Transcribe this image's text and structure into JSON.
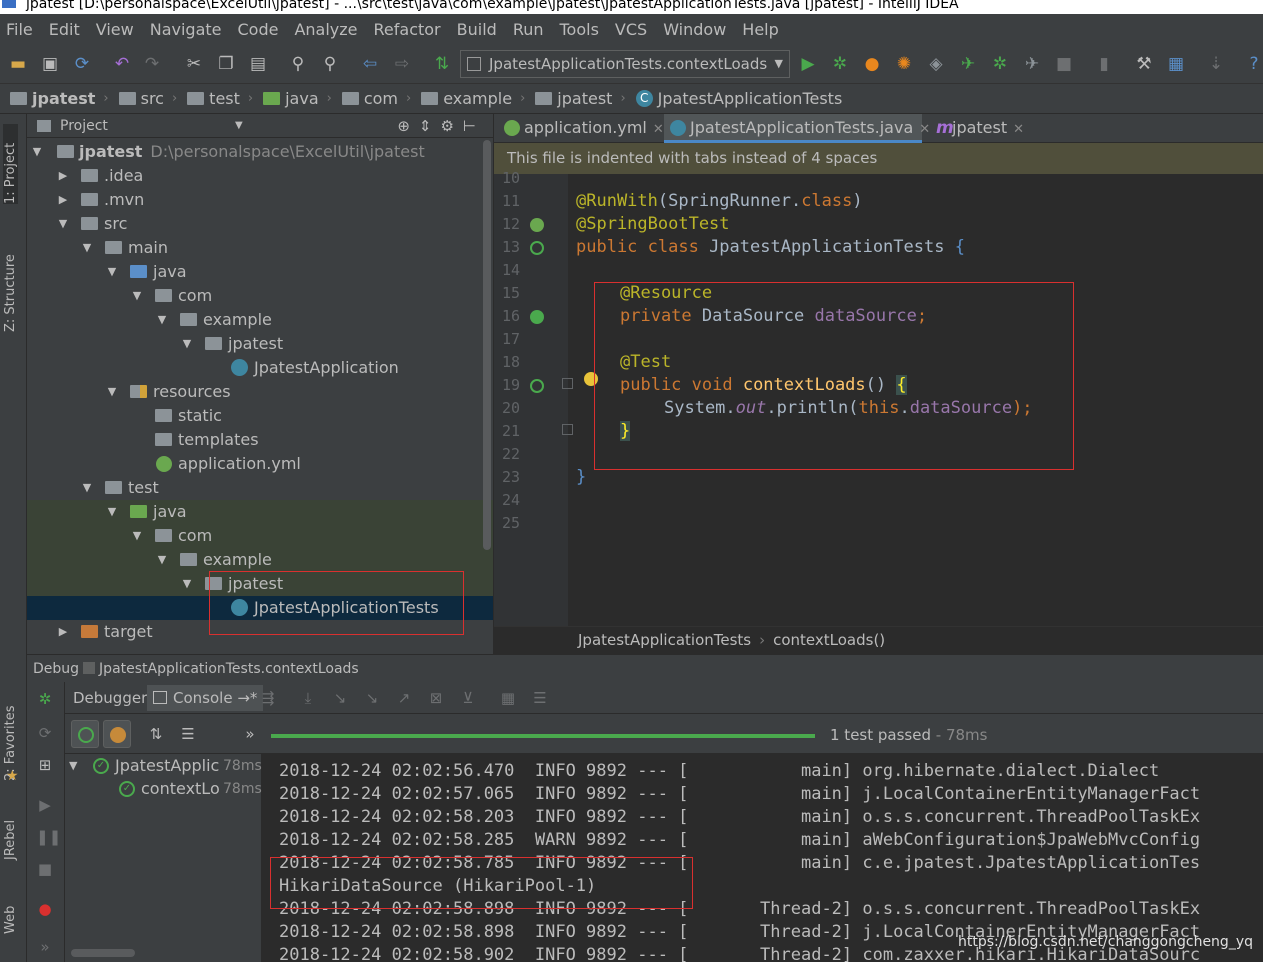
{
  "window": {
    "title": "jpatest [D:\\personalspace\\ExcelUtil\\jpatest] - ...\\src\\test\\java\\com\\example\\jpatest\\JpatestApplicationTests.java [jpatest] - IntelliJ IDEA"
  },
  "menu": [
    "File",
    "Edit",
    "View",
    "Navigate",
    "Code",
    "Analyze",
    "Refactor",
    "Build",
    "Run",
    "Tools",
    "VCS",
    "Window",
    "Help"
  ],
  "toolbar": {
    "run_config": "JpatestApplicationTests.contextLoads"
  },
  "breadcrumbs": [
    "jpatest",
    "src",
    "test",
    "java",
    "com",
    "example",
    "jpatest",
    "JpatestApplicationTests"
  ],
  "side_tabs": {
    "project": "1: Project",
    "structure": "Z: Structure",
    "favorites": "2: Favorites",
    "jrebel": "JRebel",
    "web": "Web"
  },
  "project": {
    "header": "Project",
    "tree": [
      {
        "label": "jpatest",
        "path": "D:\\personalspace\\ExcelUtil\\jpatest"
      },
      {
        "label": ".idea"
      },
      {
        "label": ".mvn"
      },
      {
        "label": "src"
      },
      {
        "label": "main"
      },
      {
        "label": "java"
      },
      {
        "label": "com"
      },
      {
        "label": "example"
      },
      {
        "label": "jpatest"
      },
      {
        "label": "JpatestApplication"
      },
      {
        "label": "resources"
      },
      {
        "label": "static"
      },
      {
        "label": "templates"
      },
      {
        "label": "application.yml"
      },
      {
        "label": "test"
      },
      {
        "label": "java"
      },
      {
        "label": "com"
      },
      {
        "label": "example"
      },
      {
        "label": "jpatest"
      },
      {
        "label": "JpatestApplicationTests"
      },
      {
        "label": "target"
      }
    ]
  },
  "editor": {
    "tabs": [
      "application.yml",
      "JpatestApplicationTests.java",
      "jpatest"
    ],
    "banner": "This file is indented with tabs instead of 4 spaces",
    "line_numbers": [
      "10",
      "11",
      "12",
      "13",
      "14",
      "15",
      "16",
      "17",
      "18",
      "19",
      "20",
      "21",
      "22",
      "23",
      "24",
      "25"
    ],
    "code": {
      "l11_an": "@RunWith",
      "l11_rest": "(SpringRunner.",
      "l11_kw": "class",
      "l11_end": ")",
      "l12": "@SpringBootTest",
      "l13_kw": "public class ",
      "l13_name": "JpatestApplicationTests ",
      "l13_br": "{",
      "l15": "@Resource",
      "l16_kw": "private ",
      "l16_type": "DataSource ",
      "l16_fld": "dataSource",
      "l16_end": ";",
      "l18": "@Test",
      "l19_kw": "public void ",
      "l19_fn": "contextLoads",
      "l19_par": "() ",
      "l19_br": "{",
      "l20_a": "System.",
      "l20_out": "out",
      "l20_b": ".println(",
      "l20_this": "this",
      "l20_c": ".",
      "l20_fld": "dataSource",
      "l20_d": ");",
      "l21": "}",
      "l23": "}"
    },
    "breadcrumb": [
      "JpatestApplicationTests",
      "contextLoads()"
    ]
  },
  "debug": {
    "title": "Debug",
    "config": "JpatestApplicationTests.contextLoads",
    "tabs": [
      "Debugger",
      "Console"
    ],
    "status": "1 test passed",
    "status_time": "- 78ms",
    "tests": [
      {
        "name": "JpatestApplic",
        "time": "78ms"
      },
      {
        "name": "contextLo",
        "time": "78ms"
      }
    ],
    "console": [
      "2018-12-24 02:02:56.470  INFO 9892 --- [           main] org.hibernate.dialect.Dialect",
      "2018-12-24 02:02:57.065  INFO 9892 --- [           main] j.LocalContainerEntityManagerFact",
      "2018-12-24 02:02:58.203  INFO 9892 --- [           main] o.s.s.concurrent.ThreadPoolTaskEx",
      "2018-12-24 02:02:58.285  WARN 9892 --- [           main] aWebConfiguration$JpaWebMvcConfig",
      "2018-12-24 02:02:58.785  INFO 9892 --- [           main] c.e.jpatest.JpatestApplicationTes",
      "HikariDataSource (HikariPool-1)",
      "2018-12-24 02:02:58.898  INFO 9892 --- [       Thread-2] o.s.s.concurrent.ThreadPoolTaskEx",
      "2018-12-24 02:02:58.898  INFO 9892 --- [       Thread-2] j.LocalContainerEntityManagerFact",
      "2018-12-24 02:02:58.902  INFO 9892 --- [       Thread-2] com.zaxxer.hikari.HikariDataSourc"
    ],
    "watermark": "https://blog.csdn.net/changgongcheng_yq"
  },
  "colors": {
    "run_green": "#4aa94d",
    "highlight_red": "#d9302f",
    "selection": "#0d293e"
  }
}
